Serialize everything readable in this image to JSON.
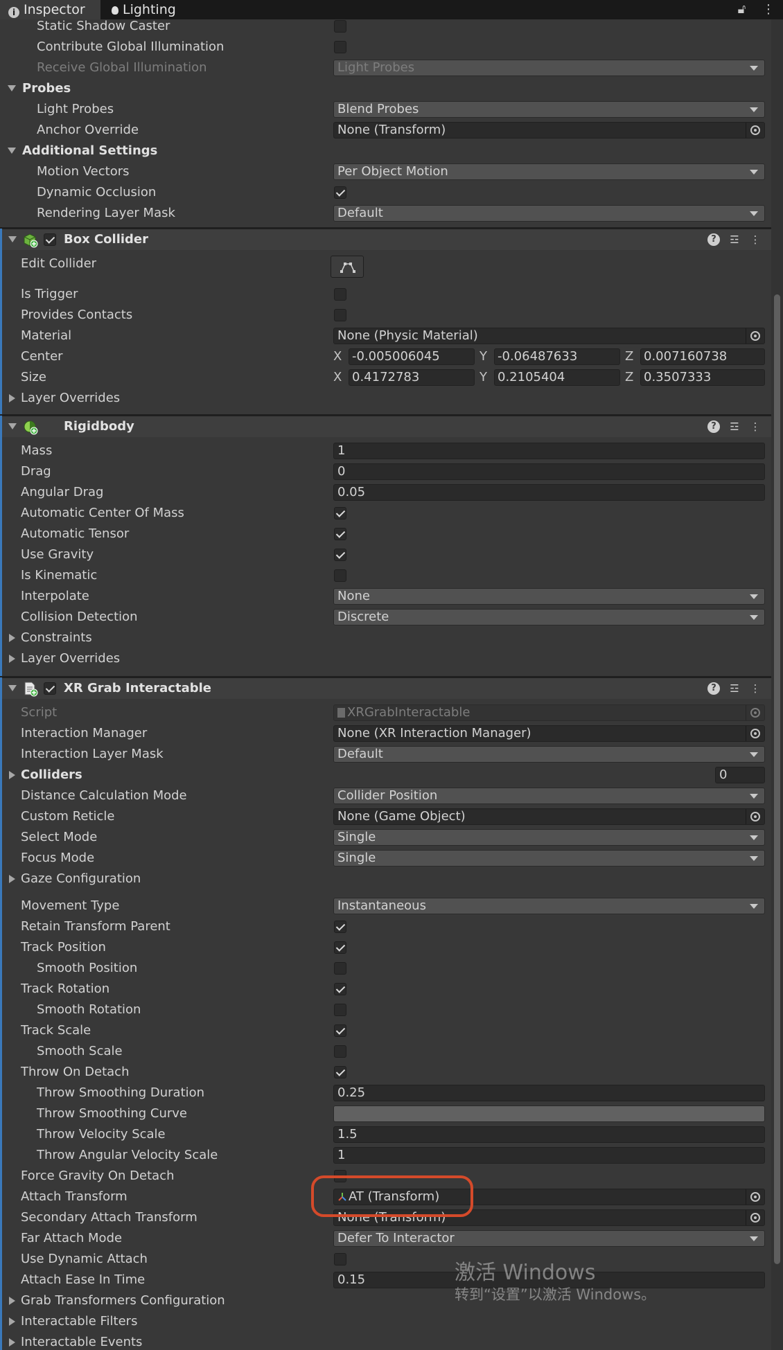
{
  "tabs": [
    {
      "label": "Inspector",
      "icon": "info-icon"
    },
    {
      "label": "Lighting",
      "icon": "lightbulb-icon"
    }
  ],
  "toolbar_icons": [
    "lock-icon",
    "kebab-menu-icon"
  ],
  "mesh_renderer_rows": [
    {
      "label": "Static Shadow Caster",
      "type": "checkbox",
      "checked": false,
      "indent": 2
    },
    {
      "label": "Contribute Global Illumination",
      "type": "checkbox",
      "checked": false,
      "indent": 2
    },
    {
      "label": "Receive Global Illumination",
      "type": "dropdown",
      "value": "Light Probes",
      "indent": 2,
      "disabled": true
    },
    {
      "label": "Probes",
      "type": "section",
      "indent": 1
    },
    {
      "label": "Light Probes",
      "type": "dropdown",
      "value": "Blend Probes",
      "indent": 2
    },
    {
      "label": "Anchor Override",
      "type": "object",
      "value": "None (Transform)",
      "indent": 2
    },
    {
      "label": "Additional Settings",
      "type": "section",
      "indent": 1
    },
    {
      "label": "Motion Vectors",
      "type": "dropdown",
      "value": "Per Object Motion",
      "indent": 2
    },
    {
      "label": "Dynamic Occlusion",
      "type": "checkbox",
      "checked": true,
      "indent": 2
    },
    {
      "label": "Rendering Layer Mask",
      "type": "dropdown",
      "value": "Default",
      "indent": 2
    }
  ],
  "box_collider": {
    "title": "Box Collider",
    "icon": "box-collider-icon",
    "enabled": true,
    "rows": [
      {
        "label": "Edit Collider",
        "type": "editbutton"
      },
      {
        "label": "Is Trigger",
        "type": "checkbox",
        "checked": false
      },
      {
        "label": "Provides Contacts",
        "type": "checkbox",
        "checked": false
      },
      {
        "label": "Material",
        "type": "object",
        "value": "None (Physic Material)"
      },
      {
        "label": "Center",
        "type": "vector",
        "x": "-0.005006045",
        "y": "-0.06487633",
        "z": "0.007160738"
      },
      {
        "label": "Size",
        "type": "vector",
        "x": "0.4172783",
        "y": "0.2105404",
        "z": "0.3507333"
      },
      {
        "label": "Layer Overrides",
        "type": "foldout"
      }
    ]
  },
  "rigidbody": {
    "title": "Rigidbody",
    "icon": "rigidbody-icon",
    "rows": [
      {
        "label": "Mass",
        "type": "number",
        "value": "1"
      },
      {
        "label": "Drag",
        "type": "number",
        "value": "0"
      },
      {
        "label": "Angular Drag",
        "type": "number",
        "value": "0.05"
      },
      {
        "label": "Automatic Center Of Mass",
        "type": "checkbox",
        "checked": true
      },
      {
        "label": "Automatic Tensor",
        "type": "checkbox",
        "checked": true
      },
      {
        "label": "Use Gravity",
        "type": "checkbox",
        "checked": true
      },
      {
        "label": "Is Kinematic",
        "type": "checkbox",
        "checked": false
      },
      {
        "label": "Interpolate",
        "type": "dropdown",
        "value": "None"
      },
      {
        "label": "Collision Detection",
        "type": "dropdown",
        "value": "Discrete"
      },
      {
        "label": "Constraints",
        "type": "foldout"
      },
      {
        "label": "Layer Overrides",
        "type": "foldout"
      }
    ]
  },
  "xr_grab": {
    "title": "XR Grab Interactable",
    "icon": "script-icon",
    "enabled": true,
    "rows": [
      {
        "label": "Script",
        "type": "object",
        "value": "XRGrabInteractable",
        "disabled": true
      },
      {
        "label": "Interaction Manager",
        "type": "object",
        "value": "None (XR Interaction Manager)"
      },
      {
        "label": "Interaction Layer Mask",
        "type": "dropdown",
        "value": "Default"
      },
      {
        "label": "Colliders",
        "type": "list",
        "value": "0"
      },
      {
        "label": "Distance Calculation Mode",
        "type": "dropdown",
        "value": "Collider Position"
      },
      {
        "label": "Custom Reticle",
        "type": "object",
        "value": "None (Game Object)"
      },
      {
        "label": "Select Mode",
        "type": "dropdown",
        "value": "Single"
      },
      {
        "label": "Focus Mode",
        "type": "dropdown",
        "value": "Single"
      },
      {
        "label": "Gaze Configuration",
        "type": "foldout"
      },
      {
        "label": "",
        "type": "spacer"
      },
      {
        "label": "Movement Type",
        "type": "dropdown",
        "value": "Instantaneous"
      },
      {
        "label": "Retain Transform Parent",
        "type": "checkbox",
        "checked": true
      },
      {
        "label": "Track Position",
        "type": "checkbox",
        "checked": true
      },
      {
        "label": "Smooth Position",
        "type": "checkbox",
        "checked": false,
        "indent": 2
      },
      {
        "label": "Track Rotation",
        "type": "checkbox",
        "checked": true
      },
      {
        "label": "Smooth Rotation",
        "type": "checkbox",
        "checked": false,
        "indent": 2
      },
      {
        "label": "Track Scale",
        "type": "checkbox",
        "checked": true
      },
      {
        "label": "Smooth Scale",
        "type": "checkbox",
        "checked": false,
        "indent": 2
      },
      {
        "label": "Throw On Detach",
        "type": "checkbox",
        "checked": true
      },
      {
        "label": "Throw Smoothing Duration",
        "type": "number",
        "value": "0.25",
        "indent": 2
      },
      {
        "label": "Throw Smoothing Curve",
        "type": "curve",
        "indent": 2
      },
      {
        "label": "Throw Velocity Scale",
        "type": "number",
        "value": "1.5",
        "indent": 2
      },
      {
        "label": "Throw Angular Velocity Scale",
        "type": "number",
        "value": "1",
        "indent": 2
      },
      {
        "label": "Force Gravity On Detach",
        "type": "checkbox",
        "checked": false
      },
      {
        "label": "Attach Transform",
        "type": "object",
        "value": "AT (Transform)",
        "objicon": "transform-icon"
      },
      {
        "label": "Secondary Attach Transform",
        "type": "object",
        "value": "None (Transform)"
      },
      {
        "label": "Far Attach Mode",
        "type": "dropdown",
        "value": "Defer To Interactor"
      },
      {
        "label": "Use Dynamic Attach",
        "type": "checkbox",
        "checked": false
      },
      {
        "label": "Attach Ease In Time",
        "type": "number",
        "value": "0.15"
      },
      {
        "label": "Grab Transformers Configuration",
        "type": "foldout"
      },
      {
        "label": "Interactable Filters",
        "type": "foldout"
      },
      {
        "label": "Interactable Events",
        "type": "foldout"
      }
    ]
  },
  "watermark": {
    "line1": "激活 Windows",
    "line2": "转到“设置”以激活 Windows。"
  }
}
